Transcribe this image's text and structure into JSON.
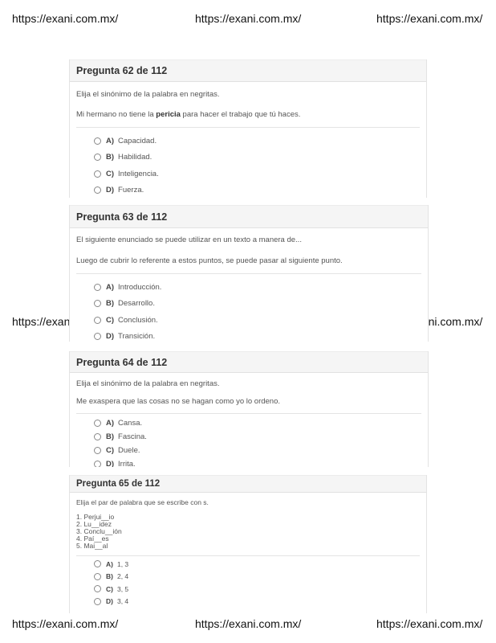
{
  "watermark": "https://exani.com.mx/",
  "watermark_partial_left": "https://exan",
  "watermark_partial_right": "ıni.com.mx/",
  "questions": [
    {
      "title": "Pregunta 62 de 112",
      "instruction": "Elija el sinónimo de la palabra en negritas.",
      "sentence_before": "Mi hermano no tiene la ",
      "sentence_bold": "pericia",
      "sentence_after": " para hacer el trabajo que tú haces.",
      "options": [
        {
          "letter": "A)",
          "text": "Capacidad."
        },
        {
          "letter": "B)",
          "text": "Habilidad."
        },
        {
          "letter": "C)",
          "text": "Inteligencia."
        },
        {
          "letter": "D)",
          "text": "Fuerza."
        }
      ]
    },
    {
      "title": "Pregunta 63 de 112",
      "instruction": "El siguiente enunciado se puede utilizar en un texto a manera de...",
      "sentence": "Luego de cubrir lo referente a estos puntos, se puede pasar al siguiente punto.",
      "options": [
        {
          "letter": "A)",
          "text": "Introducción."
        },
        {
          "letter": "B)",
          "text": "Desarrollo."
        },
        {
          "letter": "C)",
          "text": "Conclusión."
        },
        {
          "letter": "D)",
          "text": "Transición."
        }
      ]
    },
    {
      "title": "Pregunta 64 de 112",
      "instruction": "Elija el sinónimo de la palabra en negritas.",
      "sentence": "Me exaspera que las cosas no se hagan como yo lo ordeno.",
      "options": [
        {
          "letter": "A)",
          "text": "Cansa."
        },
        {
          "letter": "B)",
          "text": "Fascina."
        },
        {
          "letter": "C)",
          "text": "Duele."
        },
        {
          "letter": "D)",
          "text": "Irrita."
        }
      ]
    },
    {
      "title": "Pregunta 65 de 112",
      "instruction": "Elija el par de palabra que se escribe con s.",
      "list": [
        "1. Perjui__io",
        "2. Lu__idez",
        "3. Conclu__ión",
        "4. Paí__es",
        "5. Mai__al"
      ],
      "options": [
        {
          "letter": "A)",
          "text": "1, 3"
        },
        {
          "letter": "B)",
          "text": "2, 4"
        },
        {
          "letter": "C)",
          "text": "3, 5"
        },
        {
          "letter": "D)",
          "text": "3, 4"
        }
      ]
    }
  ]
}
